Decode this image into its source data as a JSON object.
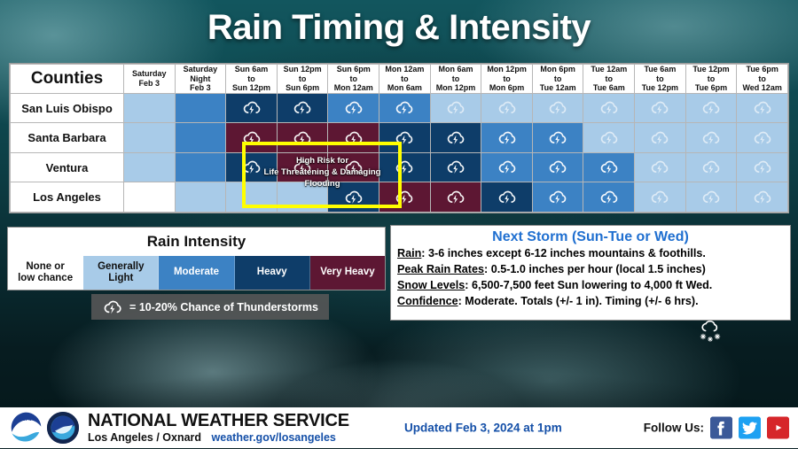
{
  "title": "Rain Timing & Intensity",
  "table": {
    "counties_header": "Counties",
    "time_columns": [
      [
        "Saturday",
        "Feb 3"
      ],
      [
        "Saturday",
        "Night",
        "Feb 3"
      ],
      [
        "Sun 6am",
        "to",
        "Sun 12pm"
      ],
      [
        "Sun 12pm",
        "to",
        "Sun 6pm"
      ],
      [
        "Sun 6pm",
        "to",
        "Mon 12am"
      ],
      [
        "Mon 12am",
        "to",
        "Mon 6am"
      ],
      [
        "Mon 6am",
        "to",
        "Mon 12pm"
      ],
      [
        "Mon 12pm",
        "to",
        "Mon 6pm"
      ],
      [
        "Mon 6pm",
        "to",
        "Tue 12am"
      ],
      [
        "Tue 12am",
        "to",
        "Tue 6am"
      ],
      [
        "Tue 6am",
        "to",
        "Tue 12pm"
      ],
      [
        "Tue 12pm",
        "to",
        "Tue 6pm"
      ],
      [
        "Tue 6pm",
        "to",
        "Wed 12am"
      ]
    ],
    "rows": [
      {
        "county": "San Luis Obispo",
        "cells": [
          {
            "intensity": "light",
            "storm": false
          },
          {
            "intensity": "mod",
            "storm": false
          },
          {
            "intensity": "heavy",
            "storm": true
          },
          {
            "intensity": "heavy",
            "storm": true
          },
          {
            "intensity": "mod",
            "storm": true
          },
          {
            "intensity": "mod",
            "storm": true
          },
          {
            "intensity": "light",
            "storm": true
          },
          {
            "intensity": "light",
            "storm": true
          },
          {
            "intensity": "light",
            "storm": true
          },
          {
            "intensity": "light",
            "storm": true
          },
          {
            "intensity": "light",
            "storm": true
          },
          {
            "intensity": "light",
            "storm": true
          },
          {
            "intensity": "light",
            "storm": true
          }
        ]
      },
      {
        "county": "Santa Barbara",
        "cells": [
          {
            "intensity": "light",
            "storm": false
          },
          {
            "intensity": "mod",
            "storm": false
          },
          {
            "intensity": "vheavy",
            "storm": true
          },
          {
            "intensity": "vheavy",
            "storm": true
          },
          {
            "intensity": "vheavy",
            "storm": true
          },
          {
            "intensity": "heavy",
            "storm": true
          },
          {
            "intensity": "heavy",
            "storm": true
          },
          {
            "intensity": "mod",
            "storm": true
          },
          {
            "intensity": "mod",
            "storm": true
          },
          {
            "intensity": "light",
            "storm": true
          },
          {
            "intensity": "light",
            "storm": true
          },
          {
            "intensity": "light",
            "storm": true
          },
          {
            "intensity": "light",
            "storm": true
          }
        ]
      },
      {
        "county": "Ventura",
        "cells": [
          {
            "intensity": "light",
            "storm": false
          },
          {
            "intensity": "mod",
            "storm": false
          },
          {
            "intensity": "heavy",
            "storm": true
          },
          {
            "intensity": "vheavy",
            "storm": true
          },
          {
            "intensity": "vheavy",
            "storm": true
          },
          {
            "intensity": "heavy",
            "storm": true
          },
          {
            "intensity": "heavy",
            "storm": true
          },
          {
            "intensity": "mod",
            "storm": true
          },
          {
            "intensity": "mod",
            "storm": true
          },
          {
            "intensity": "mod",
            "storm": true
          },
          {
            "intensity": "light",
            "storm": true
          },
          {
            "intensity": "light",
            "storm": true
          },
          {
            "intensity": "light",
            "storm": true
          }
        ]
      },
      {
        "county": "Los Angeles",
        "cells": [
          {
            "intensity": "none",
            "storm": false
          },
          {
            "intensity": "light",
            "storm": false
          },
          {
            "intensity": "light",
            "storm": false
          },
          {
            "intensity": "light",
            "storm": false
          },
          {
            "intensity": "heavy",
            "storm": true
          },
          {
            "intensity": "vheavy",
            "storm": true
          },
          {
            "intensity": "vheavy",
            "storm": true
          },
          {
            "intensity": "heavy",
            "storm": true
          },
          {
            "intensity": "mod",
            "storm": true
          },
          {
            "intensity": "mod",
            "storm": true
          },
          {
            "intensity": "light",
            "storm": true
          },
          {
            "intensity": "light",
            "storm": true
          },
          {
            "intensity": "light",
            "storm": true
          }
        ]
      }
    ],
    "risk_callout": "High Risk for\nLife Threatening & Damaging\nFlooding",
    "risk_callout_lines": [
      "High Risk for",
      "Life Threatening & Damaging",
      "Flooding"
    ],
    "risk_box_color": "#ffff00"
  },
  "legend": {
    "title": "Rain Intensity",
    "swatches": [
      {
        "label": "None or\nlow chance",
        "lines": [
          "None or",
          "low chance"
        ],
        "color": "#ffffff",
        "text": "dark"
      },
      {
        "label": "Generally\nLight",
        "lines": [
          "Generally",
          "Light"
        ],
        "color": "#a8cbe8",
        "text": "dark"
      },
      {
        "label": "Moderate",
        "lines": [
          "Moderate"
        ],
        "color": "#3c82c4",
        "text": "light"
      },
      {
        "label": "Heavy",
        "lines": [
          "Heavy"
        ],
        "color": "#0e3d69",
        "text": "light"
      },
      {
        "label": "Very Heavy",
        "lines": [
          "Very Heavy"
        ],
        "color": "#5d1733",
        "text": "light"
      }
    ],
    "thunder_note": "=  10-20% Chance of Thunderstorms",
    "thunder_icon": "thunderstorm-icon"
  },
  "next_storm": {
    "title": "Next Storm (Sun-Tue or Wed)",
    "lines": [
      {
        "label": "Rain",
        "value": ": 3-6 inches except 6-12 inches mountains & foothills."
      },
      {
        "label": "Peak Rain Rates",
        "value": ": 0.5-1.0 inches per hour (local 1.5 inches)"
      },
      {
        "label": "Snow Levels",
        "value": ": 6,500-7,500 feet Sun lowering to 4,000 ft Wed."
      },
      {
        "label": "Confidence",
        "value": ": Moderate. Totals (+/- 1 in). Timing (+/- 6 hrs)."
      }
    ],
    "title_color": "#1f6fd0"
  },
  "footer": {
    "agency_name": "NATIONAL WEATHER SERVICE",
    "office": "Los Angeles / Oxnard",
    "url": "weather.gov/losangeles",
    "updated": "Updated Feb 3, 2024 at 1pm",
    "follow_label": "Follow Us:",
    "social": [
      {
        "name": "facebook-icon",
        "glyph": "f",
        "color": "#3b5998"
      },
      {
        "name": "twitter-icon",
        "glyph": "",
        "color": "#1da1f2"
      },
      {
        "name": "youtube-icon",
        "glyph": "",
        "color": "#d6262a"
      }
    ],
    "noaa_logo": "noaa-logo",
    "nws_logo": "nws-logo"
  }
}
